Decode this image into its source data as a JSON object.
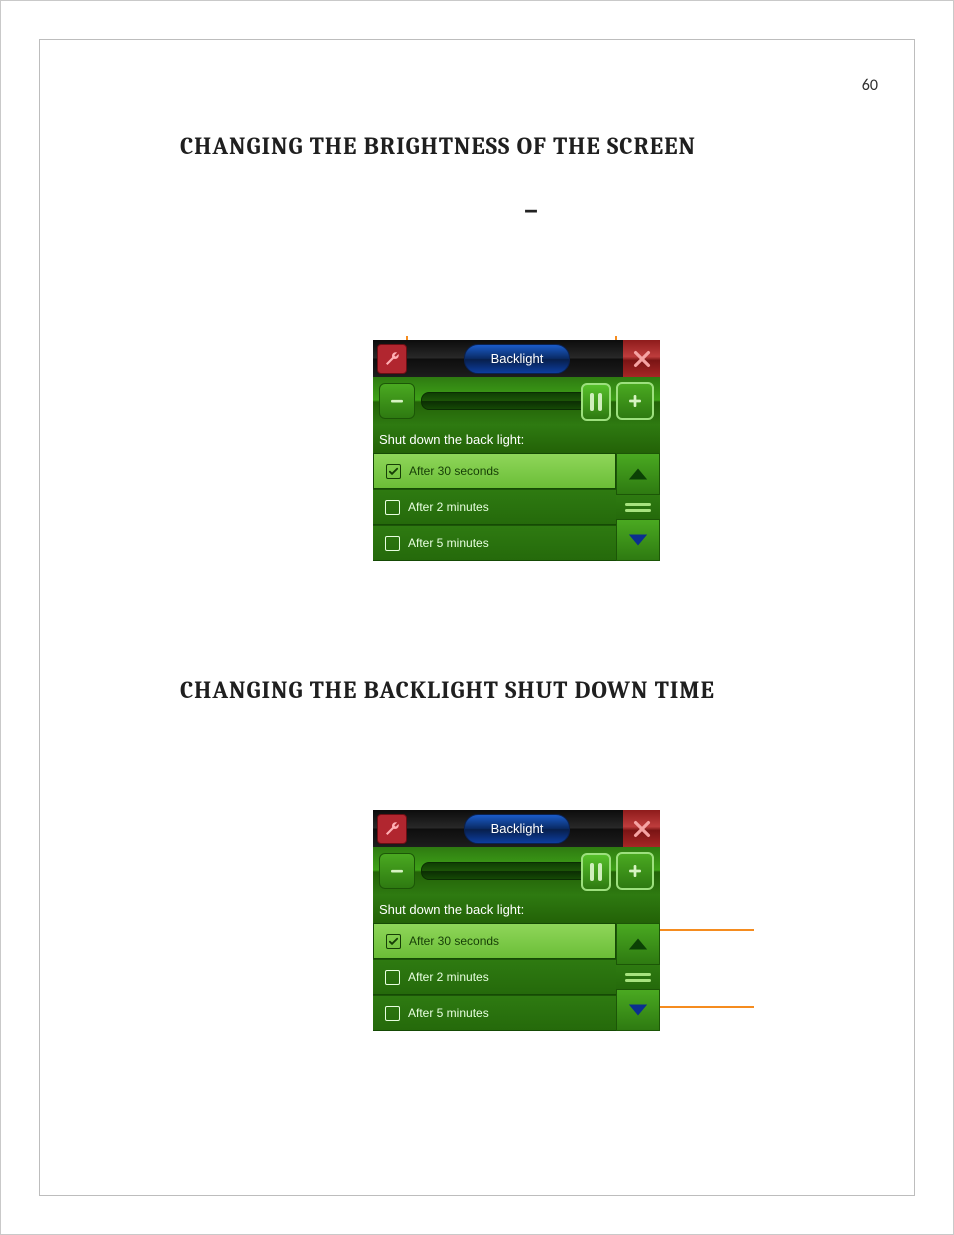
{
  "page_number": "60",
  "headings": {
    "h1": "CHANGING THE BRIGHTNESS OF THE SCREEN",
    "h2": "CHANGING THE BACKLIGHT SHUT DOWN TIME"
  },
  "panel": {
    "title": "Backlight",
    "section_label": "Shut down the back light:",
    "options": [
      {
        "label": "After 30 seconds",
        "selected": true
      },
      {
        "label": "After 2 minutes",
        "selected": false
      },
      {
        "label": "After 5 minutes",
        "selected": false
      }
    ]
  }
}
